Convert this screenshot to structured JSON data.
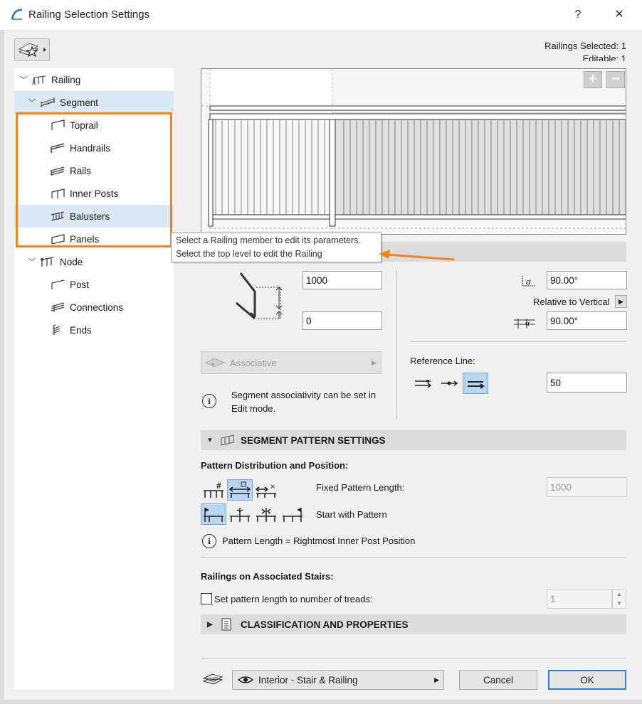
{
  "window": {
    "title": "Railing Selection Settings",
    "help_label": "?",
    "close_label": "✕"
  },
  "selection": {
    "selected": "Railings Selected: 1",
    "editable": "Editable: 1"
  },
  "tree": {
    "root": "Railing",
    "segment": "Segment",
    "segment_items": [
      "Toprail",
      "Handrails",
      "Rails",
      "Inner Posts",
      "Balusters",
      "Panels"
    ],
    "node": "Node",
    "node_items": [
      "Post",
      "Connections",
      "Ends"
    ]
  },
  "tooltip": {
    "line1": "Select a Railing member to edit its parameters.",
    "line2": "Select the top level to edit the Railing"
  },
  "preview": {
    "zoom_in": "+",
    "zoom_out": "−"
  },
  "geometry": {
    "height_value": "1000",
    "offset_value": "0",
    "angle1_value": "90.00°",
    "relative_label": "Relative to Vertical",
    "angle2_value": "90.00°",
    "associative_label": "Associative",
    "info_text_1": "Segment associativity can be set in",
    "info_text_2": "Edit mode.",
    "reference_line_label": "Reference Line:",
    "reference_offset_value": "50"
  },
  "pattern": {
    "section_title": "SEGMENT PATTERN SETTINGS",
    "distribution_label": "Pattern Distribution and Position:",
    "fixed_length_label": "Fixed Pattern Length:",
    "fixed_length_value": "1000",
    "start_with_label": "Start with Pattern",
    "info_text": "Pattern Length = Rightmost Inner Post Position",
    "stairs_label": "Railings on Associated Stairs:",
    "treads_label": "Set pattern length to number of treads:",
    "treads_value": "1"
  },
  "classification": {
    "section_title": "CLASSIFICATION AND PROPERTIES"
  },
  "footer": {
    "favorite_value": "Interior - Stair & Railing",
    "cancel_label": "Cancel",
    "ok_label": "OK"
  },
  "colors": {
    "accent_orange": "#f58220",
    "selection_blue": "#dbe9f7",
    "ok_border": "#2b79d6"
  }
}
